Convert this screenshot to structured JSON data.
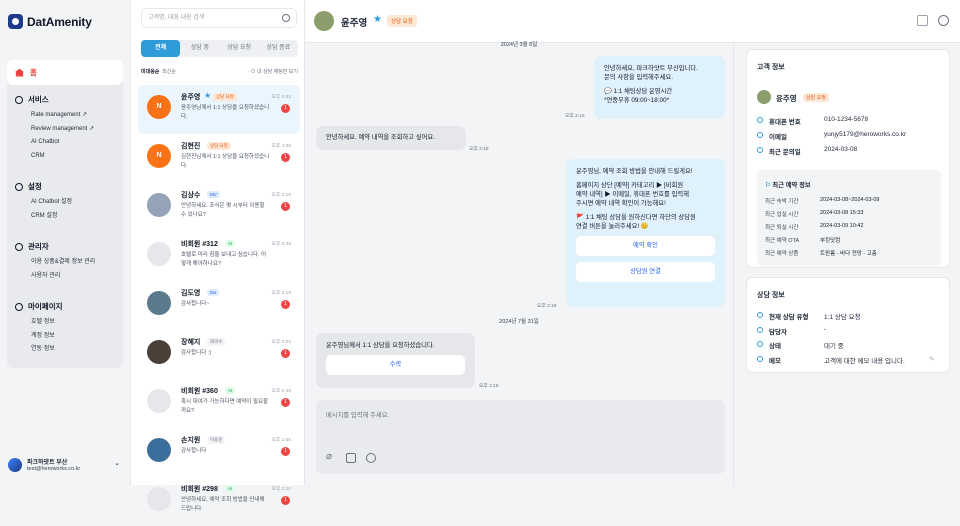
{
  "app": {
    "logo_text": "DatAmenity"
  },
  "sidebar": {
    "home": "홈",
    "sections": [
      {
        "title": "서비스",
        "items": [
          "Rate management",
          "Review management",
          "AI Chatbot",
          "CRM"
        ]
      },
      {
        "title": "설정",
        "items": [
          "AI Chatbot 설정",
          "CRM 설정"
        ]
      },
      {
        "title": "관리자",
        "items": [
          "이용 상품&결제 정보 관리",
          "사용자 관리"
        ]
      },
      {
        "title": "마이페이지",
        "items": [
          "호텔 정보",
          "계정 정보",
          "연동 정보"
        ]
      }
    ],
    "profile": {
      "name": "파크하얏트 부산",
      "email": "test@heroworks.co.kr"
    }
  },
  "list": {
    "search_placeholder": "고객명, 대화 내용 검색",
    "tabs": [
      "전체",
      "상담 중",
      "상담 요청",
      "상담 종료"
    ],
    "sort_active": "미대응순",
    "sort_other": "최신순",
    "filter_label": "내 상담 채팅만 보기",
    "items": [
      {
        "name": "윤주영",
        "star": "★",
        "badge": "상담 요청",
        "badge_color": "orange",
        "time": "오후 4:42",
        "preview": "윤주영님께서 1:1 상담을 요청하셨습니다.",
        "unread": "1",
        "avatar": "N"
      },
      {
        "name": "김현진",
        "badge": "상담 요청",
        "badge_color": "orange",
        "time": "오후 4:36",
        "preview": "김현진님께서 1:1 상담을 요청하셨습니다.",
        "unread": "1",
        "avatar": "N"
      },
      {
        "name": "김상수",
        "badge": "MV",
        "badge_color": "blue",
        "time": "오후 3:15",
        "preview": "안녕하세요. 조식은 몇 시부터 이용할 수 있나요?",
        "unread": "1",
        "avatar": ""
      },
      {
        "name": "비회원 #312",
        "badge": "AI",
        "badge_color": "green",
        "time": "오후 3:46",
        "preview": "호텔로 미리 짐을 보내고 싶습니다. 어떻게 해야하나요?",
        "unread": "",
        "avatar": ""
      },
      {
        "name": "김도영",
        "badge": "Mo",
        "badge_color": "blue",
        "time": "오후 3:15",
        "preview": "감사합니다~",
        "unread": "1",
        "avatar": ""
      },
      {
        "name": "장혜지",
        "badge": "회의수",
        "badge_color": "gray",
        "time": "오후 3:02",
        "preview": "감사합니다 :)",
        "unread": "1",
        "avatar": ""
      },
      {
        "name": "비회원 #360",
        "badge": "AI",
        "badge_color": "green",
        "time": "오후 2:46",
        "preview": "혹시 대여가 가능하다면 예약이 필요할까요?",
        "unread": "1",
        "avatar": ""
      },
      {
        "name": "손지원",
        "badge": "이용문",
        "badge_color": "gray",
        "time": "오후 1:55",
        "preview": "감사합니다",
        "unread": "1",
        "avatar": ""
      },
      {
        "name": "비회원 #298",
        "badge": "AI",
        "badge_color": "green",
        "time": "오후 2:10",
        "preview": "안녕하세요, 예약 조회 방법을 안내해 드립니다.",
        "unread": "1",
        "avatar": ""
      }
    ]
  },
  "chat": {
    "header": {
      "name": "윤주영",
      "star": "★",
      "badge": "상담 요청"
    },
    "date1": "2024년 3월 8일",
    "m1": {
      "lines": [
        "안녕하세요, 파크하얏트 부산입니다.",
        "문의 사항을 입력해주세요.",
        "",
        "💬 1:1 채팅상담 운영시간",
        "*연중무휴 09:00~18:00*"
      ],
      "time": "오후 2:19"
    },
    "m2": {
      "text": "안녕하세요. 예약 내역을 조회하고 싶어요.",
      "time": "오후 2:18"
    },
    "m3": {
      "lines": [
        "윤주영님, 예약 조회 방법을 안내해 드릴게요!",
        "",
        "홈페이지 상단 [예약] 카테고리 ▶ [비회원",
        "예약 내역] ▶ 이메일, 휴대폰 번호를 입력해",
        "주시면 예약 내역 확인이 가능해요!",
        "",
        "🚩 1:1 채팅 상담을 원하신다면 하단의 상담원",
        "연결 버튼을 눌러주세요! 😊"
      ],
      "btn1": "예약 확인",
      "btn2": "상담원 연결",
      "time": "오후 2:19"
    },
    "date2": "2024년 7월 31일",
    "m4": {
      "text": "윤주영님께서 1:1 상담을 요청하셨습니다.",
      "btn": "수락",
      "time": "오후 2:18"
    },
    "input_placeholder": "메시지를 입력해 주세요."
  },
  "customer": {
    "title": "고객 정보",
    "name": "윤주영",
    "badge": "상담 요청",
    "fields": [
      {
        "k": "휴대폰 번호",
        "v": "010-1234-5678"
      },
      {
        "k": "이메일",
        "v": "yunjy5179@heroworks.co.kr"
      },
      {
        "k": "최근 문의일",
        "v": "2024-03-08"
      }
    ],
    "recent_title": "최근 예약 정보",
    "recent": [
      {
        "k": "최근 숙박 기간",
        "v": "2024-03-08~2024-03-09"
      },
      {
        "k": "최근 입실 시간",
        "v": "2024-03-08 15:33"
      },
      {
        "k": "최근 퇴실 시간",
        "v": "2024-03-09 10:42"
      },
      {
        "k": "최근 예약 OTA",
        "v": "부킹닷컴"
      },
      {
        "k": "최근 예약 상품",
        "v": "트윈룸 - 바다 전망 - 고층"
      }
    ]
  },
  "consult": {
    "title": "상담 정보",
    "fields": [
      {
        "k": "현재 상담 유형",
        "v": "1:1 상담 요청"
      },
      {
        "k": "담당자",
        "v": "-"
      },
      {
        "k": "상태",
        "v": "대기 중"
      },
      {
        "k": "메모",
        "v": "고객에 대한 메모 내용 입니다."
      }
    ]
  }
}
